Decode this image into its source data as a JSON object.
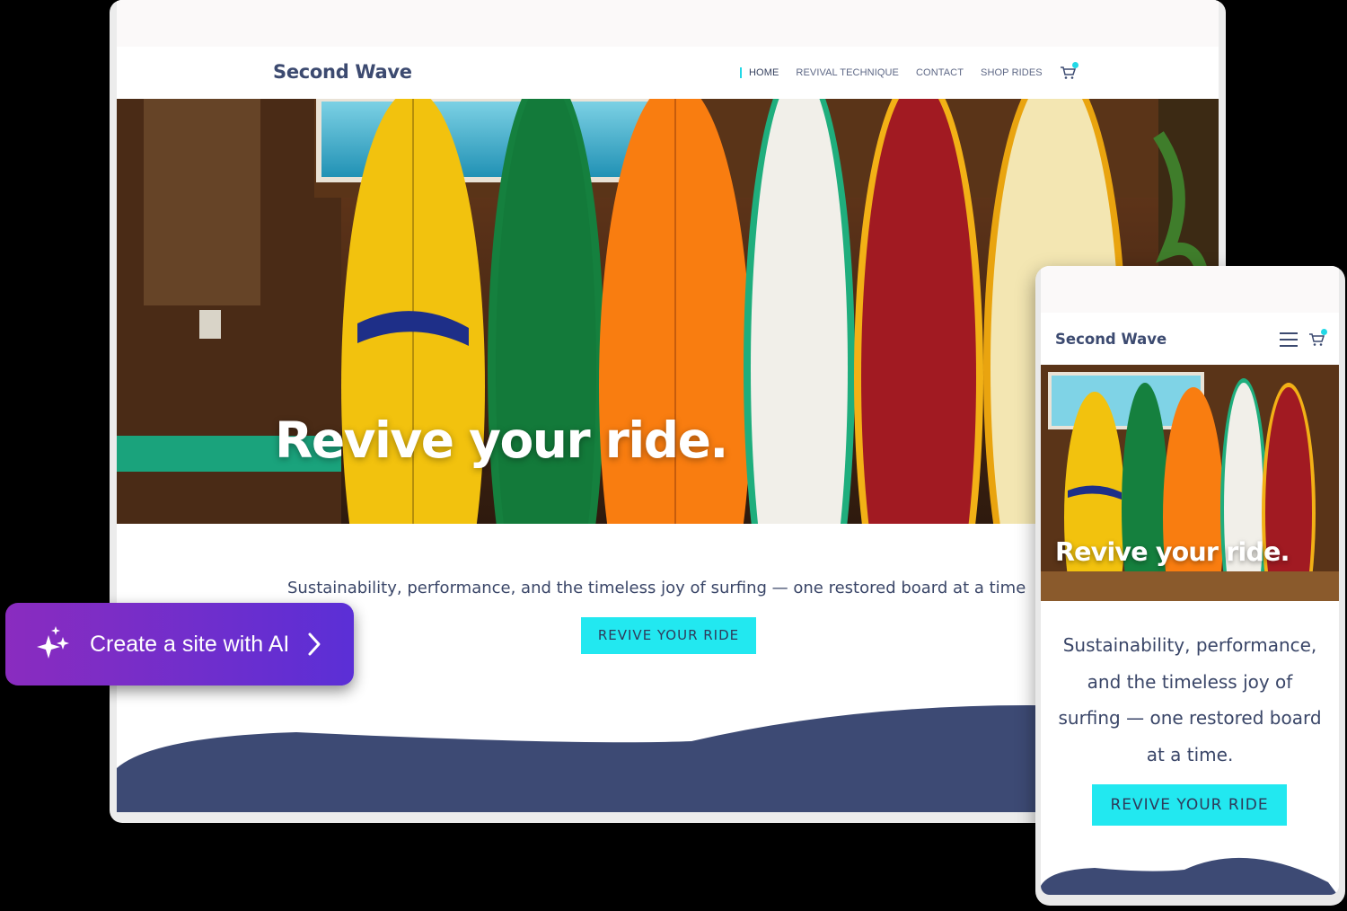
{
  "desktop": {
    "brand": "Second Wave",
    "nav": [
      {
        "label": "HOME",
        "active": true
      },
      {
        "label": "REVIVAL TECHNIQUE",
        "active": false
      },
      {
        "label": "CONTACT",
        "active": false
      },
      {
        "label": "SHOP RIDES",
        "active": false
      }
    ],
    "cart_icon": "cart-icon",
    "hero_title": "Revive your ride.",
    "tagline": "Sustainability, performance, and the timeless joy of surfing — one restored board at a time",
    "cta": "REVIVE YOUR RIDE"
  },
  "mobile": {
    "brand": "Second Wave",
    "menu_icon": "hamburger-icon",
    "cart_icon": "cart-icon",
    "hero_title": "Revive your ride.",
    "tagline": "Sustainability, performance, and the timeless joy of surfing — one restored board at a time.",
    "cta": "REVIVE YOUR RIDE"
  },
  "ai_button": {
    "label": "Create a site with AI",
    "icon": "sparkles-icon",
    "chevron": "chevron-right-icon"
  },
  "colors": {
    "brand_navy": "#3c4a70",
    "accent_cyan": "#22e8f0",
    "ai_gradient_start": "#8a2cbf",
    "ai_gradient_end": "#5b2fd6"
  }
}
